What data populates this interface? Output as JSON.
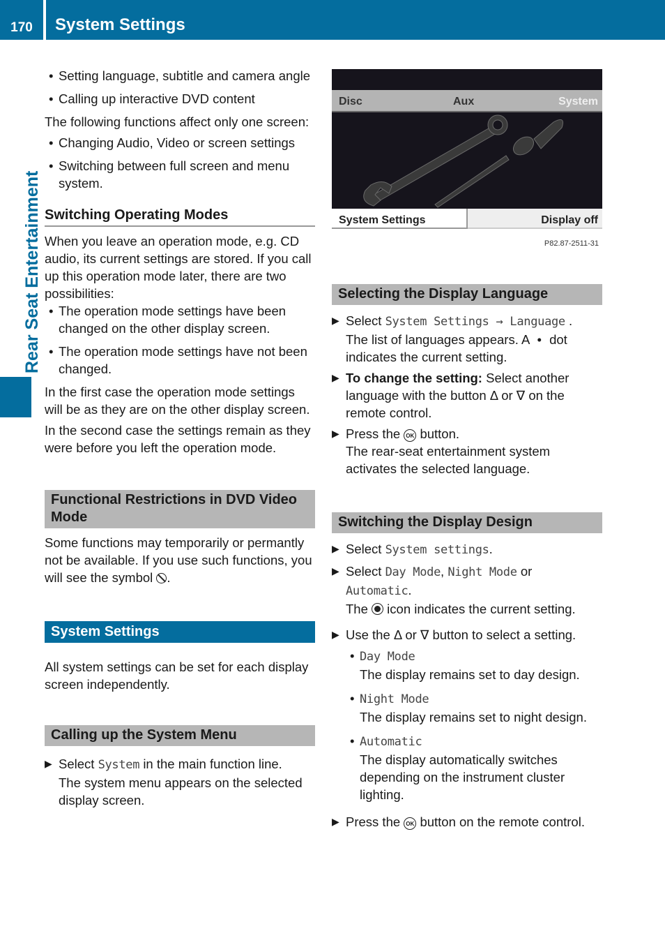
{
  "header": {
    "page_number": "170",
    "title": "System Settings"
  },
  "side_label": "Rear Seat Entertainment",
  "left": {
    "intro_bullets_1": [
      "Setting language, subtitle and camera angle",
      "Calling up interactive DVD content"
    ],
    "intro_para": "The following functions affect only one screen:",
    "intro_bullets_2": [
      "Changing Audio, Video or screen settings",
      "Switching between full screen and menu system."
    ],
    "switching": {
      "heading": "Switching Operating Modes",
      "para": "When you leave an operation mode, e.g. CD audio, its current settings are stored. If you call up this operation mode later, there are two possibilities:",
      "bullets": [
        "The operation mode settings have been changed on the other display screen.",
        "The operation mode settings have not been changed."
      ],
      "para2": "In the first case the operation mode settings will be as they are on the other display screen.",
      "para3": "In the second case the settings remain as they were before you left the operation mode."
    },
    "restrictions": {
      "heading": "Functional Restrictions in DVD Video Mode",
      "para": "Some functions may temporarily or permantly not be available. If you use such functions, you will see the symbol",
      "para_end": ".",
      "symbol_icon": "prohibited-icon"
    },
    "system_settings": {
      "heading": "System Settings",
      "para": "All system settings can be set for each display screen independently."
    },
    "calling": {
      "heading": "Calling up the System Menu",
      "step_pre": "Select",
      "step_code": "System",
      "step_post": "in the main function line.",
      "result": "The system menu appears on the selected display screen."
    }
  },
  "figure": {
    "tabs": [
      "Disc",
      "Aux",
      "System"
    ],
    "buttons": [
      "System Settings",
      "Display off"
    ],
    "code": "P82.87-2511-31"
  },
  "right": {
    "language": {
      "heading": "Selecting the Display Language",
      "step1_pre": "Select",
      "step1_code": "System Settings → Language",
      "step1_post": ".",
      "step1_result_a": "The list of languages appears. A",
      "step1_result_dot": "•",
      "step1_result_b": "dot indicates the current setting.",
      "step2_bold": "To change the setting:",
      "step2_text": "Select another language with the button Δ or ∇ on the remote control.",
      "step3_pre": "Press the",
      "step3_icon_label": "OK",
      "step3_post": "button.",
      "step3_result": "The rear-seat entertainment system activates the selected language."
    },
    "design": {
      "heading": "Switching the Display Design",
      "step1_pre": "Select",
      "step1_code": "System settings",
      "step1_post": ".",
      "step2_pre": "Select",
      "step2_code1": "Day Mode",
      "step2_sep": ",",
      "step2_code2": "Night Mode",
      "step2_or": "or",
      "step2_code3": "Automatic",
      "step2_end": ".",
      "step2_result_a": "The",
      "step2_result_b": "icon indicates the current setting.",
      "step3": "Use the Δ or ∇ button to select a setting.",
      "options": [
        {
          "name": "Day Mode",
          "desc": "The display remains set to day design."
        },
        {
          "name": "Night Mode",
          "desc": "The display remains set to night design."
        },
        {
          "name": "Automatic",
          "desc": "The display automatically switches depending on the instrument cluster lighting."
        }
      ],
      "step4_pre": "Press the",
      "step4_icon_label": "OK",
      "step4_post": "button on the remote control."
    }
  },
  "colors": {
    "brand_blue": "#046d9e",
    "heading_gray": "#b6b6b6"
  }
}
